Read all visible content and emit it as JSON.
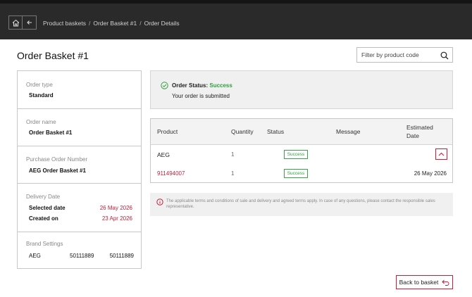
{
  "breadcrumb": [
    "Product baskets",
    "Order Basket #1",
    "Order Details"
  ],
  "page_title": "Order Basket #1",
  "filter": {
    "placeholder": "Filter by product code",
    "value": ""
  },
  "sidebar": {
    "order_type": {
      "label": "Order type",
      "value": "Standard"
    },
    "order_name": {
      "label": "Order name",
      "value": "Order Basket #1"
    },
    "po_number": {
      "label": "Purchase Order Number",
      "value": "AEG Order Basket #1"
    },
    "delivery": {
      "label": "Delivery Date",
      "selected_label": "Selected date",
      "selected_value": "26 May 2026",
      "created_label": "Created on",
      "created_value": "23 Apr 2026"
    },
    "brand": {
      "label": "Brand Settings",
      "name": "AEG",
      "code1": "50111889",
      "code2": "50111889"
    }
  },
  "status": {
    "label": "Order Status:",
    "value": "Success",
    "message": "Your order is submitted"
  },
  "table": {
    "headers": {
      "product": "Product",
      "quantity": "Quantity",
      "status": "Status",
      "message": "Message",
      "date_line1": "Estimated",
      "date_line2": "Date"
    },
    "group": {
      "product": "AEG",
      "quantity": "1",
      "status": "Success"
    },
    "item": {
      "product": "911494007",
      "quantity": "1",
      "status": "Success",
      "date": "26 May 2026"
    }
  },
  "terms": "The applicable terms and conditions of sale and delivery and agreed terms apply. In case of any questions, please contact the responsible sales representative.",
  "back_button": "Back to basket",
  "colors": {
    "accent": "#c0203a",
    "success": "#2e9e3c",
    "header_bg": "#2a2a2a"
  }
}
